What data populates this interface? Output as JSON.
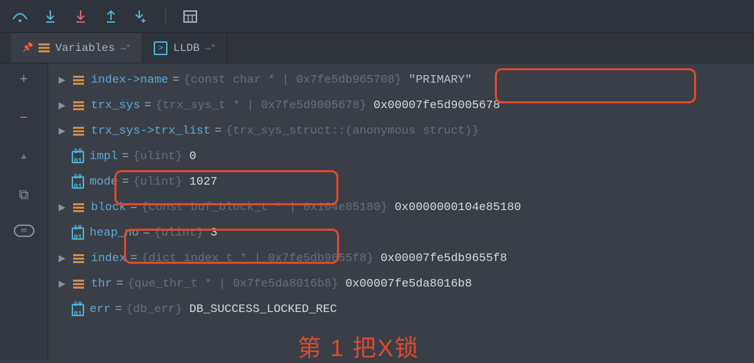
{
  "tabs": {
    "variables": "Variables",
    "lldb": "LLDB"
  },
  "gutter": {
    "plus": "+",
    "minus": "−",
    "up": "▲",
    "copy": "⧉",
    "watch": "∞"
  },
  "rows": [
    {
      "name": "index->name",
      "type": "{const char * | 0x7fe5db965708}",
      "val": "\"PRIMARY\"",
      "icon": "struct",
      "expand": true
    },
    {
      "name": "trx_sys",
      "type": "{trx_sys_t * | 0x7fe5d9005678}",
      "val": "0x00007fe5d9005678",
      "icon": "struct",
      "expand": true
    },
    {
      "name": "trx_sys->trx_list",
      "type": "{trx_sys_struct::(anonymous struct)}",
      "val": "",
      "icon": "struct",
      "expand": true
    },
    {
      "name": "impl",
      "type": "{ulint}",
      "val": "0",
      "icon": "prim",
      "expand": false
    },
    {
      "name": "mode",
      "type": "{ulint}",
      "val": "1027",
      "icon": "prim",
      "expand": false
    },
    {
      "name": "block",
      "type": "{const buf_block_t * | 0x104e85180}",
      "val": "0x0000000104e85180",
      "icon": "struct",
      "expand": true
    },
    {
      "name": "heap_no",
      "type": "{ulint}",
      "val": "3",
      "icon": "prim",
      "expand": false
    },
    {
      "name": "index",
      "type": "{dict_index_t * | 0x7fe5db9655f8}",
      "val": "0x00007fe5db9655f8",
      "icon": "struct",
      "expand": true
    },
    {
      "name": "thr",
      "type": "{que_thr_t * | 0x7fe5da8016b8}",
      "val": "0x00007fe5da8016b8",
      "icon": "struct",
      "expand": true
    },
    {
      "name": "err",
      "type": "{db_err}",
      "val": "DB_SUCCESS_LOCKED_REC",
      "icon": "prim",
      "expand": false
    }
  ],
  "caption": "第 1 把X锁"
}
